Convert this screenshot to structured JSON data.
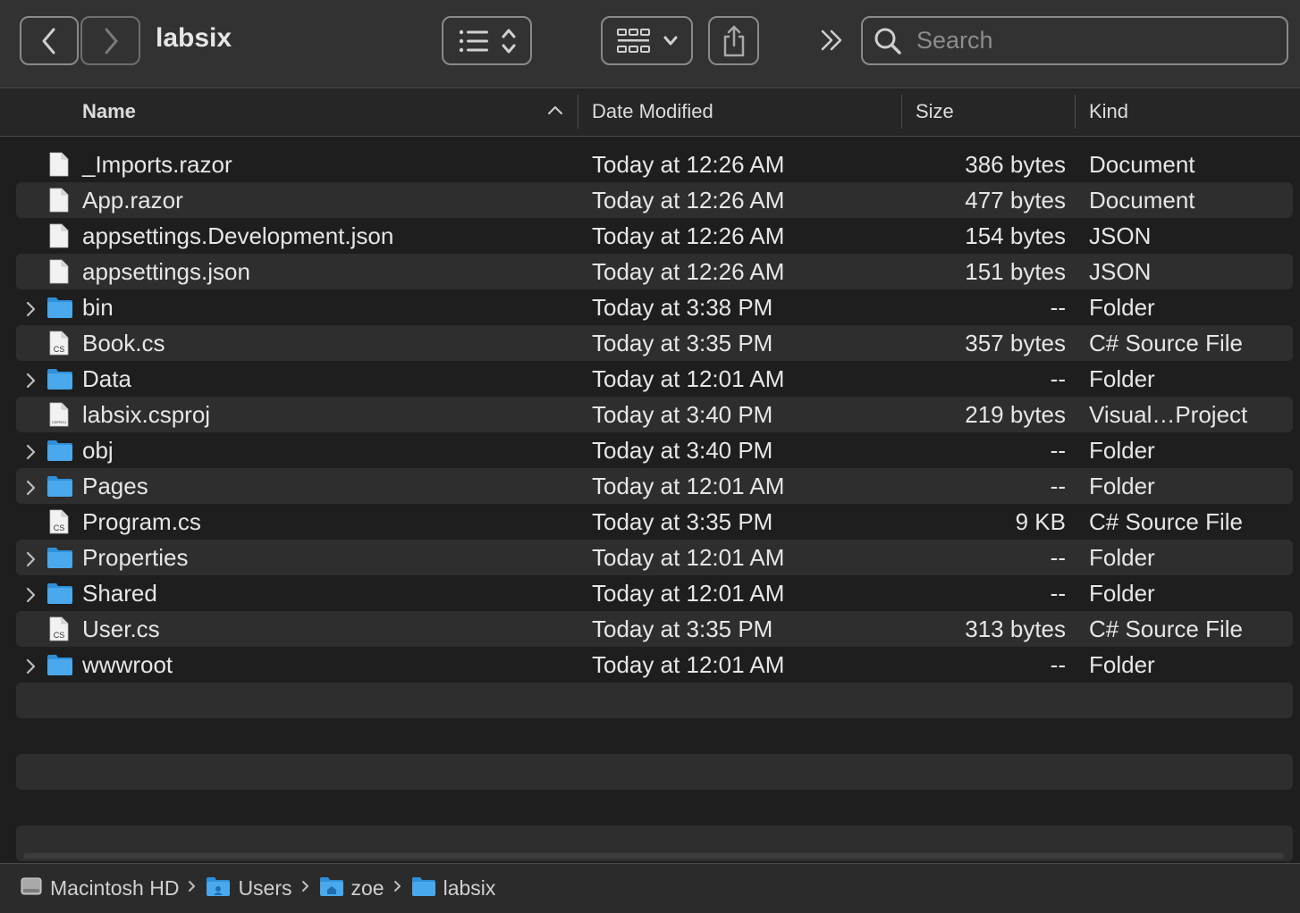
{
  "window": {
    "title": "labsix"
  },
  "toolbar": {
    "back_icon": "chevron-left-icon",
    "forward_icon": "chevron-right-icon",
    "view_list_icon": "list-view-icon",
    "view_grid_icon": "grid-view-icon",
    "share_icon": "share-icon",
    "more_icon": "double-chevron-icon",
    "search_placeholder": "Search"
  },
  "columns": {
    "name": "Name",
    "date": "Date Modified",
    "size": "Size",
    "kind": "Kind"
  },
  "files": [
    {
      "name": "_Imports.razor",
      "date": "Today at 12:26 AM",
      "size": "386 bytes",
      "kind": "Document",
      "type": "doc",
      "expandable": false
    },
    {
      "name": "App.razor",
      "date": "Today at 12:26 AM",
      "size": "477 bytes",
      "kind": "Document",
      "type": "doc",
      "expandable": false
    },
    {
      "name": "appsettings.Development.json",
      "date": "Today at 12:26 AM",
      "size": "154 bytes",
      "kind": "JSON",
      "type": "doc",
      "expandable": false
    },
    {
      "name": "appsettings.json",
      "date": "Today at 12:26 AM",
      "size": "151 bytes",
      "kind": "JSON",
      "type": "doc",
      "expandable": false
    },
    {
      "name": "bin",
      "date": "Today at 3:38 PM",
      "size": "--",
      "kind": "Folder",
      "type": "folder",
      "expandable": true
    },
    {
      "name": "Book.cs",
      "date": "Today at 3:35 PM",
      "size": "357 bytes",
      "kind": "C# Source File",
      "type": "cs",
      "expandable": false
    },
    {
      "name": "Data",
      "date": "Today at 12:01 AM",
      "size": "--",
      "kind": "Folder",
      "type": "folder",
      "expandable": true
    },
    {
      "name": "labsix.csproj",
      "date": "Today at 3:40 PM",
      "size": "219 bytes",
      "kind": "Visual…Project",
      "type": "csproj",
      "expandable": false
    },
    {
      "name": "obj",
      "date": "Today at 3:40 PM",
      "size": "--",
      "kind": "Folder",
      "type": "folder",
      "expandable": true
    },
    {
      "name": "Pages",
      "date": "Today at 12:01 AM",
      "size": "--",
      "kind": "Folder",
      "type": "folder",
      "expandable": true
    },
    {
      "name": "Program.cs",
      "date": "Today at 3:35 PM",
      "size": "9 KB",
      "kind": "C# Source File",
      "type": "cs",
      "expandable": false
    },
    {
      "name": "Properties",
      "date": "Today at 12:01 AM",
      "size": "--",
      "kind": "Folder",
      "type": "folder",
      "expandable": true
    },
    {
      "name": "Shared",
      "date": "Today at 12:01 AM",
      "size": "--",
      "kind": "Folder",
      "type": "folder",
      "expandable": true
    },
    {
      "name": "User.cs",
      "date": "Today at 3:35 PM",
      "size": "313 bytes",
      "kind": "C# Source File",
      "type": "cs",
      "expandable": false
    },
    {
      "name": "wwwroot",
      "date": "Today at 12:01 AM",
      "size": "--",
      "kind": "Folder",
      "type": "folder",
      "expandable": true
    }
  ],
  "icon_badges": {
    "cs": "CS",
    "csproj": "CSPROJ"
  },
  "pathbar": [
    {
      "label": "Macintosh HD",
      "icon": "hard-drive-icon"
    },
    {
      "label": "Users",
      "icon": "users-folder-icon"
    },
    {
      "label": "zoe",
      "icon": "home-folder-icon"
    },
    {
      "label": "labsix",
      "icon": "folder-icon"
    }
  ],
  "colors": {
    "folder": "#4aa8ec",
    "folder_tab": "#2f8fd8",
    "row_alt": "#2e2e2e"
  }
}
